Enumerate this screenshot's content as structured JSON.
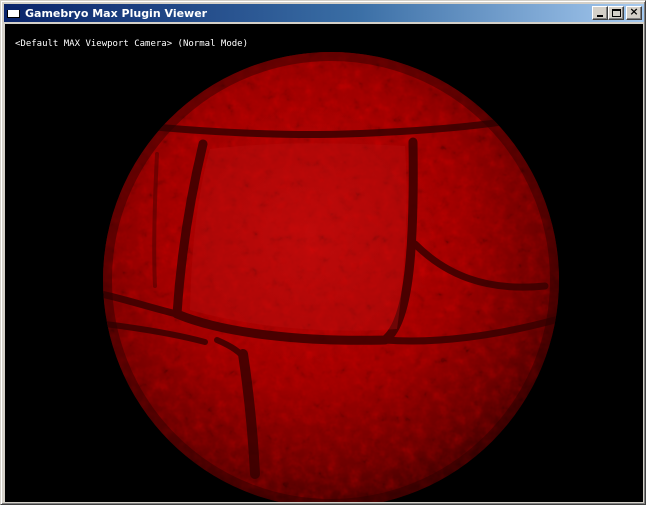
{
  "window": {
    "title": "Gamebryo Max Plugin Viewer",
    "icon": "app-window-icon"
  },
  "caption_buttons": {
    "minimize_icon": "minimize-icon",
    "maximize_icon": "maximize-icon",
    "close_icon": "close-icon",
    "close_glyph": "×"
  },
  "viewport": {
    "camera_label": "<Default MAX Viewport Camera> (Normal Mode)",
    "background_color": "#000000",
    "object": "textured-sphere",
    "object_color": "#b00000"
  },
  "colors": {
    "title_gradient_start": "#0a246a",
    "title_gradient_end": "#a6caf0",
    "chrome": "#d4d0c8"
  }
}
